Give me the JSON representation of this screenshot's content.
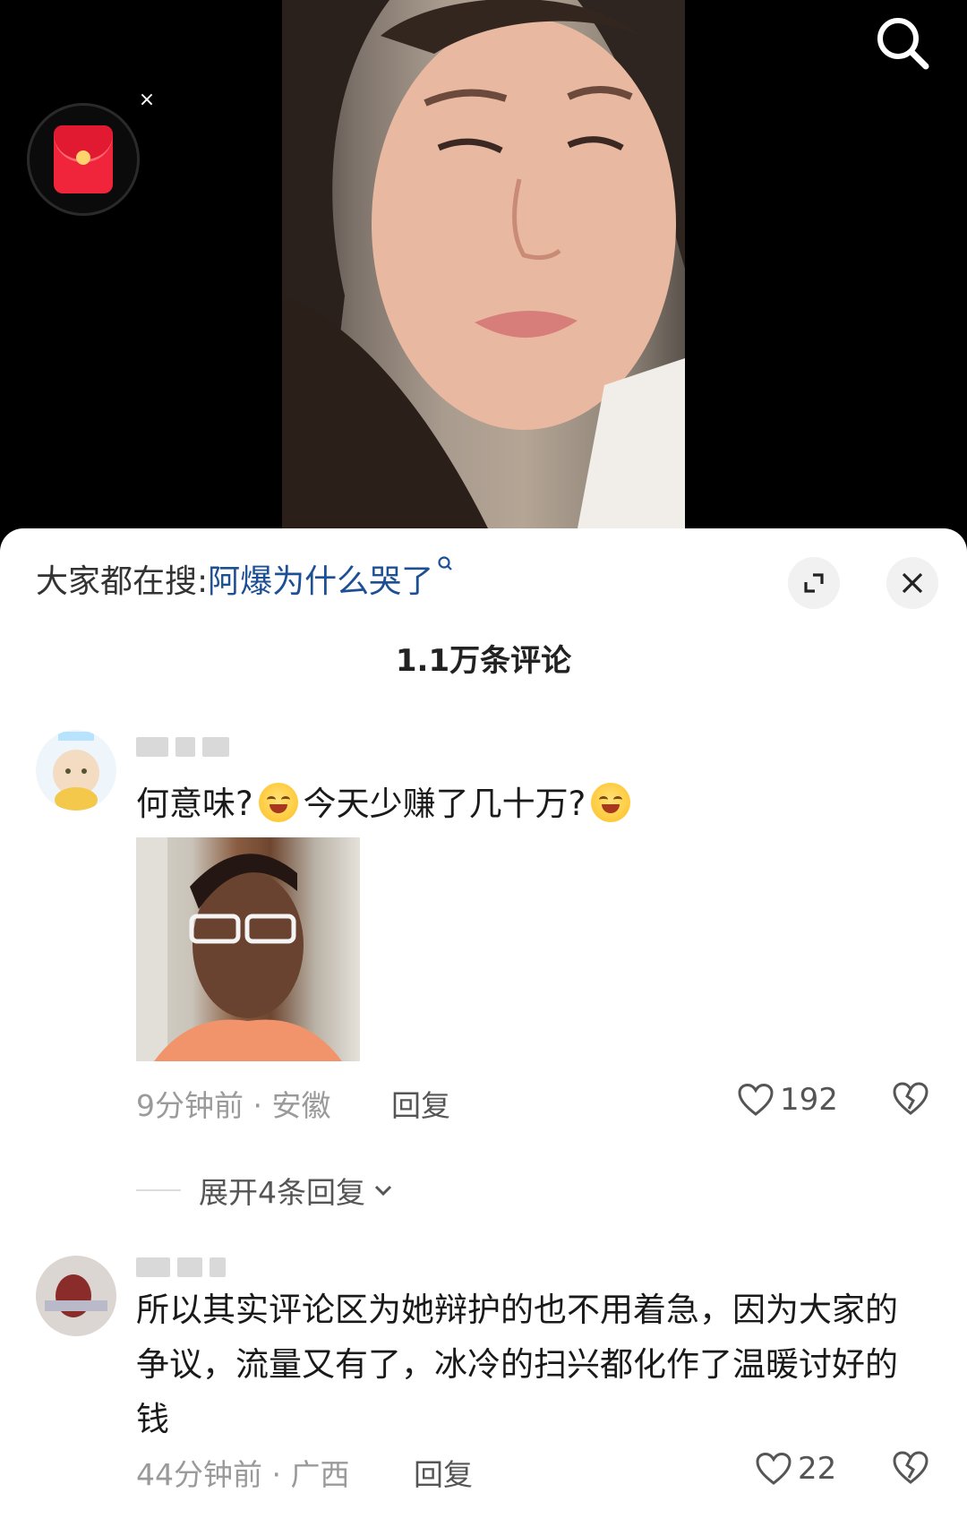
{
  "sheet": {
    "search_prefix": "大家都在搜:",
    "search_keyword": "阿爆为什么哭了",
    "comment_count": "1.1万条评论"
  },
  "comments": [
    {
      "text_part1": "何意味?",
      "text_part2": "今天少赚了几十万?",
      "meta": "9分钟前 · 安徽",
      "reply_label": "回复",
      "likes": "192",
      "expand_replies": "展开4条回复"
    },
    {
      "text": "所以其实评论区为她辩护的也不用着急，因为大家的争议，流量又有了，冰冷的扫兴都化作了温暖讨好的钱",
      "meta": "44分钟前 · 广西",
      "reply_label": "回复",
      "likes": "22"
    }
  ],
  "colors": {
    "keyword": "#1c4f94",
    "red_packet": "#f0253c",
    "meta_text": "#9a9a9a"
  },
  "icons": [
    "search-icon",
    "red-packet-icon",
    "expand-icon",
    "close-icon",
    "heart-icon",
    "broken-heart-icon",
    "chevron-down-icon",
    "emoji-icon"
  ]
}
